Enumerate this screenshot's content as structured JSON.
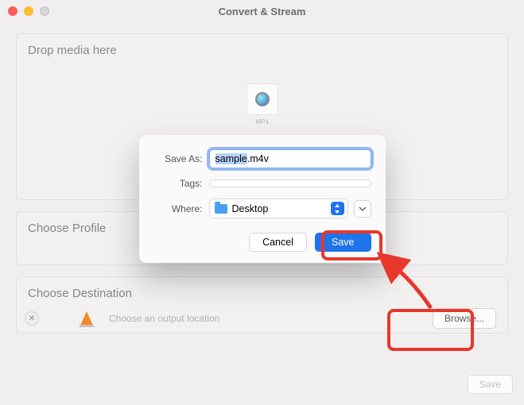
{
  "window": {
    "title": "Convert & Stream"
  },
  "drop": {
    "title": "Drop media here",
    "thumb_label": "MP4"
  },
  "profile": {
    "title": "Choose Profile"
  },
  "destination": {
    "title": "Choose Destination",
    "placeholder": "Choose an output location",
    "browse_label": "Browse..."
  },
  "bottom": {
    "save_label": "Save"
  },
  "sheet": {
    "save_as_label": "Save As:",
    "filename_selected": "sample",
    "filename_ext": ".m4v",
    "tags_label": "Tags:",
    "where_label": "Where:",
    "where_value": "Desktop",
    "cancel_label": "Cancel",
    "save_label": "Save"
  }
}
